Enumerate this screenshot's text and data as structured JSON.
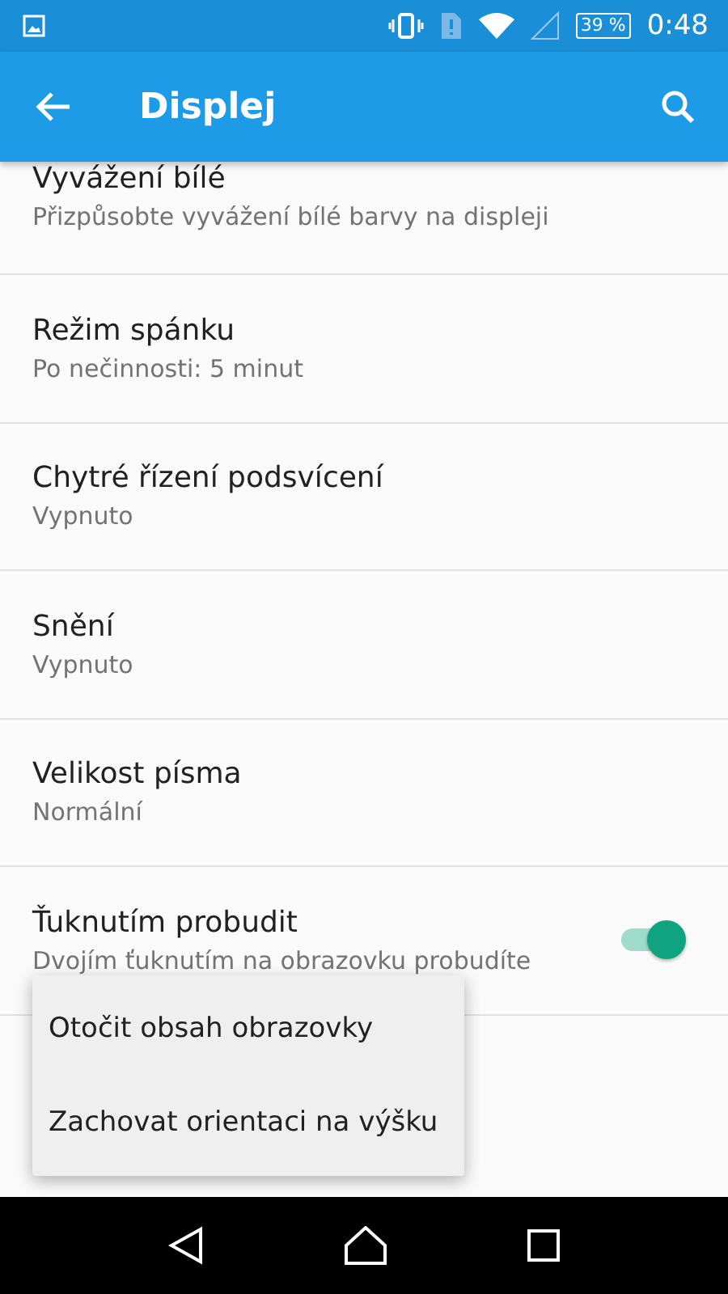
{
  "status_bar": {
    "battery": "39 %",
    "time": "0:48"
  },
  "app_bar": {
    "title": "Displej"
  },
  "settings": [
    {
      "title": "Vyvážení bílé",
      "subtitle": "Přizpůsobte vyvážení bílé barvy na displeji",
      "kind": "text"
    },
    {
      "title": "Režim spánku",
      "subtitle": "Po nečinnosti: 5 minut",
      "kind": "text"
    },
    {
      "title": "Chytré řízení podsvícení",
      "subtitle": "Vypnuto",
      "kind": "text"
    },
    {
      "title": "Snění",
      "subtitle": "Vypnuto",
      "kind": "text"
    },
    {
      "title": "Velikost písma",
      "subtitle": "Normální",
      "kind": "text"
    },
    {
      "title": "Ťuknutím probudit",
      "subtitle": "Dvojím ťuknutím na obrazovku probudíte",
      "kind": "switch",
      "on": true
    }
  ],
  "popup_menu": [
    "Otočit obsah obrazovky",
    "Zachovat orientaci na výšku"
  ]
}
